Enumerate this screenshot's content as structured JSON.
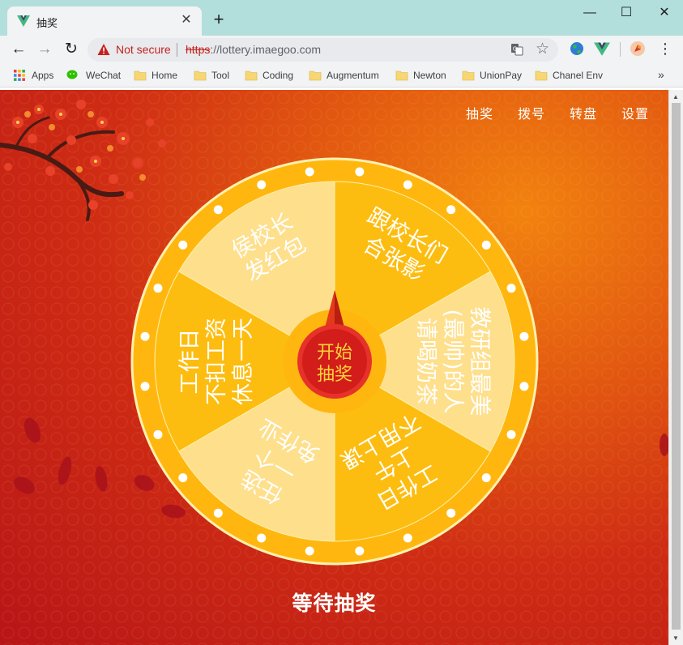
{
  "browser": {
    "tab_title": "抽奖",
    "new_tab": "+",
    "window_controls": {
      "minimize": "—",
      "maximize": "☐",
      "close": "✕"
    },
    "nav": {
      "back": "←",
      "forward": "→",
      "reload": "↻"
    },
    "security_label": "Not secure",
    "url_scheme": "https",
    "url_rest": "://lottery.imaegoo.com",
    "bookmarks": [
      "Apps",
      "WeChat",
      "Home",
      "Tool",
      "Coding",
      "Augmentum",
      "Newton",
      "UnionPay",
      "Chanel Env"
    ],
    "bookmarks_more": "»",
    "menu": "⋮",
    "star": "☆"
  },
  "page": {
    "nav": [
      "抽奖",
      "拨号",
      "转盘",
      "设置"
    ],
    "wheel": {
      "prizes": [
        {
          "lines": [
            "跟校长们",
            "合张影"
          ]
        },
        {
          "lines": [
            "教研组最美",
            "(最帅)的人",
            "请喝奶茶"
          ]
        },
        {
          "lines": [
            "工作日",
            "上午",
            "不用上课"
          ]
        },
        {
          "lines": [
            "任选",
            "一个",
            "免作业"
          ]
        },
        {
          "lines": [
            "工作日",
            "不扣工资",
            "休息一天"
          ]
        },
        {
          "lines": [
            "侯校长",
            "发红包"
          ]
        }
      ],
      "center_button": [
        "开始",
        "抽奖"
      ],
      "colors": {
        "rim": "#ffb70f",
        "rim_border": "#fff1b0",
        "light_sector": "#fedf8c",
        "dark_sector": "#fdbd10",
        "pointer": "#e33a1a",
        "center": "#d21d1b",
        "center_text": "#ffd23a"
      }
    },
    "status": "等待抽奖"
  }
}
